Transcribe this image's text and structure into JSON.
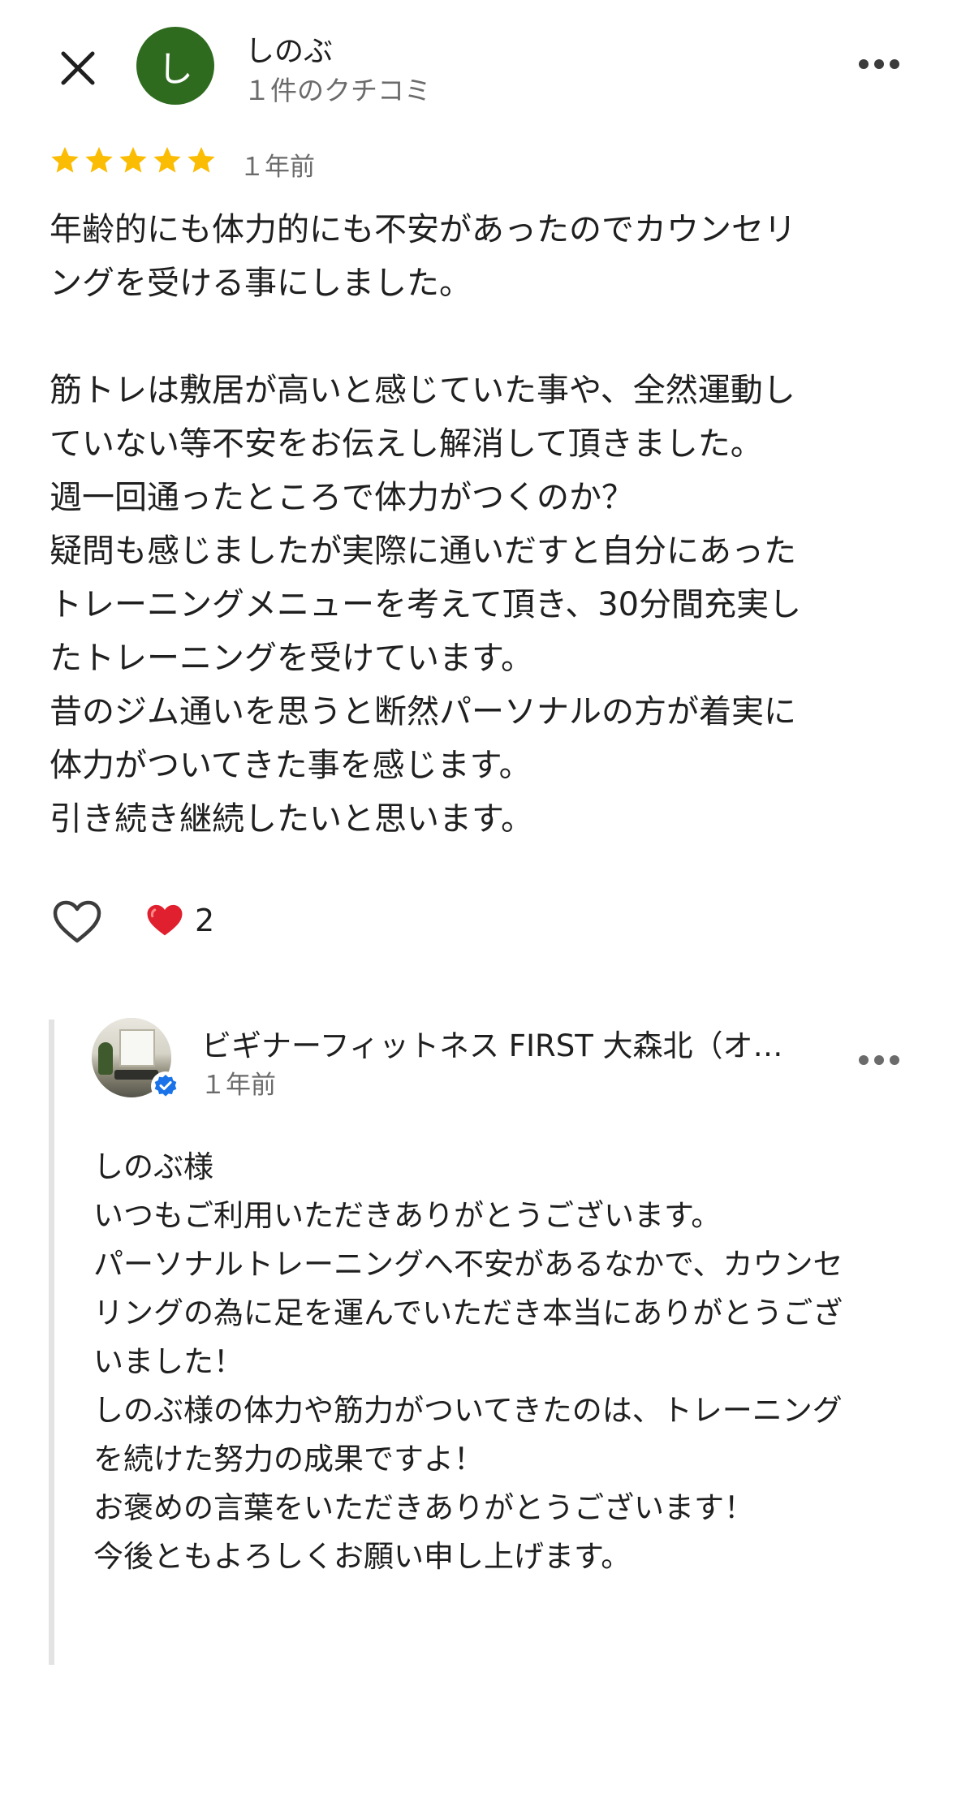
{
  "header": {
    "avatar_initial": "し",
    "avatar_color": "#2f6b1f",
    "reviewer_name": "しのぶ",
    "reviewer_meta": "１件のクチコミ",
    "close_icon": "close-icon",
    "more_icon": "more-horizontal-icon"
  },
  "rating": {
    "stars": 5,
    "max_stars": 5,
    "star_color": "#fbbc04",
    "time": "１年前"
  },
  "review": {
    "paragraphs": [
      [
        "年齢的にも体力的にも不安があったのでカウンセリ",
        "ングを受ける事にしました。"
      ],
      [
        "筋トレは敷居が高いと感じていた事や、全然運動し",
        "ていない等不安をお伝えし解消して頂きました。",
        "週一回通ったところで体力がつくのか？",
        "疑問も感じましたが実際に通いだすと自分にあった",
        "トレーニングメニューを考えて頂き、30分間充実し",
        "たトレーニングを受けています。",
        "昔のジム通いを思うと断然パーソナルの方が着実に",
        "体力がついてきた事を感じます。",
        "引き続き継続したいと思います。"
      ]
    ]
  },
  "actions": {
    "like_icon": "heart-outline-icon",
    "reaction_icon": "red-heart-icon",
    "reaction_count": "2"
  },
  "owner_reply": {
    "owner_name": "ビギナーフィットネス FIRST 大森北（オ…",
    "time": "１年前",
    "verified_icon": "verified-badge-icon",
    "more_icon": "more-horizontal-icon",
    "lines": [
      "しのぶ様",
      "いつもご利用いただきありがとうございます。",
      "パーソナルトレーニングへ不安があるなかで、カウンセ",
      "リングの為に足を運んでいただき本当にありがとうござ",
      "いました！",
      "しのぶ様の体力や筋力がついてきたのは、トレーニング",
      "を続けた努力の成果ですよ！",
      "お褒めの言葉をいただきありがとうございます！",
      "今後ともよろしくお願い申し上げます。"
    ]
  }
}
